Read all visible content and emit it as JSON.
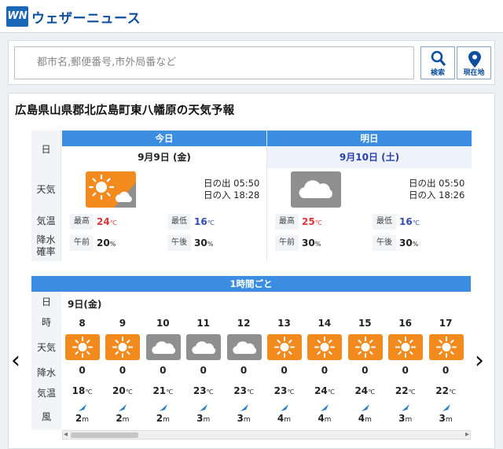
{
  "brand": {
    "logo_text": "WN",
    "name": "ウェザーニュース"
  },
  "search": {
    "placeholder": "都市名,郵便番号,市外局番など",
    "search_label": "検索",
    "location_label": "現在地"
  },
  "page_title": "広島県山県郡北広島町東八幡原の天気予報",
  "labels": {
    "day": "日",
    "weather": "天気",
    "temp": "気温",
    "pop_1": "降水",
    "pop_2": "確率",
    "high": "最高",
    "low": "最低",
    "am": "午前",
    "pm": "午後",
    "unit_c": "℃",
    "unit_pct": "%",
    "unit_m": "m"
  },
  "today": {
    "head": "今日",
    "date": "9月9日 (金)",
    "icon": "sun-and-cloud-icon",
    "sunrise": "日の出 05:50",
    "sunset": "日の入 18:28",
    "high": "24",
    "low": "16",
    "pop_am": "20",
    "pop_pm": "30"
  },
  "tomorrow": {
    "head": "明日",
    "date": "9月10日 (土)",
    "icon": "cloud-icon",
    "sunrise": "日の出 05:50",
    "sunset": "日の入 18:26",
    "high": "25",
    "low": "16",
    "pop_am": "30",
    "pop_pm": "30"
  },
  "hourly": {
    "head": "1時間ごと",
    "labels": {
      "day": "日",
      "hour": "時",
      "weather": "天気",
      "precip": "降水",
      "temp": "気温",
      "wind": "風"
    },
    "day_label": "9日(金)",
    "hours": [
      {
        "h": "8",
        "wx": "sun",
        "p": "0",
        "t": "18",
        "ws": "2"
      },
      {
        "h": "9",
        "wx": "sun",
        "p": "0",
        "t": "20",
        "ws": "2"
      },
      {
        "h": "10",
        "wx": "cloud",
        "p": "0",
        "t": "21",
        "ws": "2"
      },
      {
        "h": "11",
        "wx": "cloud",
        "p": "0",
        "t": "23",
        "ws": "3"
      },
      {
        "h": "12",
        "wx": "cloud",
        "p": "0",
        "t": "23",
        "ws": "3"
      },
      {
        "h": "13",
        "wx": "sun",
        "p": "0",
        "t": "23",
        "ws": "4"
      },
      {
        "h": "14",
        "wx": "sun",
        "p": "0",
        "t": "24",
        "ws": "4"
      },
      {
        "h": "15",
        "wx": "sun",
        "p": "0",
        "t": "24",
        "ws": "4"
      },
      {
        "h": "16",
        "wx": "sun",
        "p": "0",
        "t": "22",
        "ws": "3"
      },
      {
        "h": "17",
        "wx": "sun",
        "p": "0",
        "t": "22",
        "ws": "3"
      }
    ]
  },
  "nav": {
    "prev": "‹",
    "next": "›"
  },
  "colors": {
    "accent": "#3a8de0",
    "sun_bg": "#f28a1d",
    "cloud_bg": "#8f8f8f",
    "high": "#d9373a",
    "low": "#2f4bb8"
  }
}
